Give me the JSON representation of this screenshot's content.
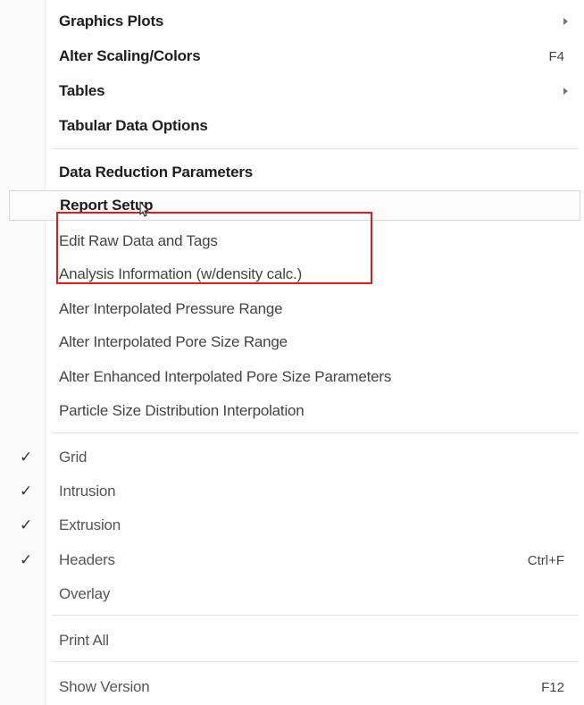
{
  "menu": {
    "items": [
      {
        "label": "Graphics Plots",
        "submenu": true
      },
      {
        "label": "Alter Scaling/Colors",
        "shortcut": "F4"
      },
      {
        "label": "Tables",
        "submenu": true
      },
      {
        "label": "Tabular Data Options"
      },
      {
        "label": "Data Reduction Parameters"
      },
      {
        "label": "Report Setup"
      },
      {
        "label": "Edit Raw Data and Tags"
      },
      {
        "label": "Analysis Information (w/density calc.)"
      },
      {
        "label": "Alter Interpolated Pressure Range"
      },
      {
        "label": "Alter Interpolated Pore Size Range"
      },
      {
        "label": "Alter Enhanced Interpolated Pore Size Parameters"
      },
      {
        "label": "Particle Size Distribution Interpolation"
      },
      {
        "label": "Grid",
        "checked": true
      },
      {
        "label": "Intrusion",
        "checked": true
      },
      {
        "label": "Extrusion",
        "checked": true
      },
      {
        "label": "Headers",
        "checked": true,
        "shortcut": "Ctrl+F"
      },
      {
        "label": "Overlay"
      },
      {
        "label": "Print All"
      },
      {
        "label": "Show Version",
        "shortcut": "F12"
      }
    ],
    "check_glyph": "✓",
    "hovered_item": "Report Setup",
    "annotation_color": "#e01b1b",
    "cursor_icon": "arrow-cursor-icon"
  }
}
